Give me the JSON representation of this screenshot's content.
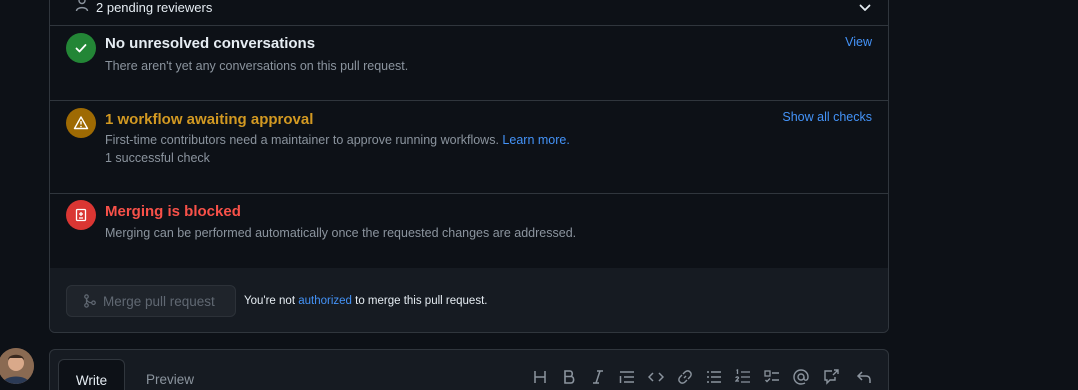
{
  "reviewers": {
    "label": "2 pending reviewers"
  },
  "conversations": {
    "title": "No unresolved conversations",
    "description": "There aren't yet any conversations on this pull request.",
    "link": "View",
    "status_color": "#238636"
  },
  "workflow": {
    "title": "1 workflow awaiting approval",
    "description": "First-time contributors need a maintainer to approve running workflows.",
    "learn_more": "Learn more.",
    "checks": "1 successful check",
    "link": "Show all checks",
    "status_color": "#9e6a03",
    "title_color": "#d29922"
  },
  "blocked": {
    "title": "Merging is blocked",
    "description": "Merging can be performed automatically once the requested changes are addressed.",
    "status_color": "#da3633",
    "title_color": "#f85149"
  },
  "merge": {
    "button_label": "Merge pull request",
    "note_prefix": "You're not",
    "note_link": "authorized",
    "note_suffix": "to merge this pull request."
  },
  "comment": {
    "tabs": [
      "Write",
      "Preview"
    ],
    "toolbar_icons": [
      "heading-icon",
      "bold-icon",
      "italic-icon",
      "quote-icon",
      "code-icon",
      "link-icon",
      "unordered-list-icon",
      "ordered-list-icon",
      "task-list-icon",
      "mention-icon",
      "cross-reference-icon",
      "reply-icon"
    ]
  }
}
